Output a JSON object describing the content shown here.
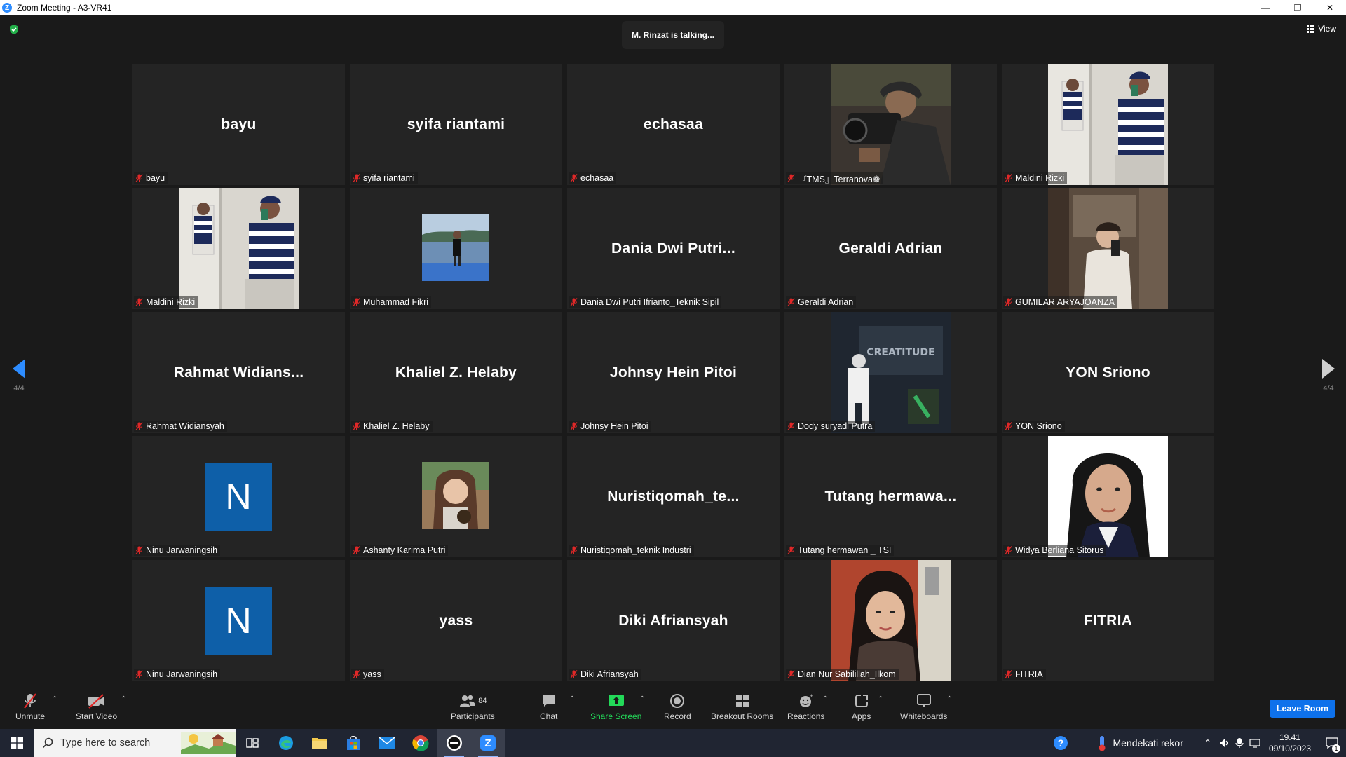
{
  "window": {
    "title": "Zoom Meeting - A3-VR41",
    "controls": [
      "minimize",
      "restore",
      "close"
    ]
  },
  "meeting": {
    "talking_indicator": "M. Rinzat is talking...",
    "view_label": "View",
    "page_left": "4/4",
    "page_right": "4/4"
  },
  "tiles": [
    {
      "display": "bayu",
      "label": "bayu",
      "kind": "name"
    },
    {
      "display": "syifa riantami",
      "label": "syifa riantami",
      "kind": "name"
    },
    {
      "display": "echasaa",
      "label": "echasaa",
      "kind": "name"
    },
    {
      "display": "",
      "label": "『TMS』Terranova❁",
      "kind": "photo",
      "photo": "camera-operator"
    },
    {
      "display": "",
      "label": "Maldini Rizki",
      "kind": "photo",
      "photo": "mirror-selfie"
    },
    {
      "display": "",
      "label": "Maldini Rizki",
      "kind": "photo",
      "photo": "mirror-selfie"
    },
    {
      "display": "",
      "label": "Muhammad Fikri",
      "kind": "photo-sm",
      "photo": "boat"
    },
    {
      "display": "Dania Dwi Putri...",
      "label": "Dania Dwi Putri Ifrianto_Teknik Sipil",
      "kind": "name"
    },
    {
      "display": "Geraldi Adrian",
      "label": "Geraldi Adrian",
      "kind": "name"
    },
    {
      "display": "",
      "label": "GUMILAR ARYAJOANZA",
      "kind": "photo",
      "photo": "selfie-room"
    },
    {
      "display": "Rahmat  Widians...",
      "label": "Rahmat Widiansyah",
      "kind": "name"
    },
    {
      "display": "Khaliel Z. Helaby",
      "label": "Khaliel Z. Helaby",
      "kind": "name"
    },
    {
      "display": "Johnsy Hein Pitoi",
      "label": "Johnsy Hein Pitoi",
      "kind": "name"
    },
    {
      "display": "",
      "label": "Dody suryadi Putra",
      "kind": "photo",
      "photo": "studio"
    },
    {
      "display": "YON Sriono",
      "label": "YON Sriono",
      "kind": "name"
    },
    {
      "display": "N",
      "label": "Ninu Jarwaningsih",
      "kind": "avatar"
    },
    {
      "display": "",
      "label": "Ashanty Karima Putri",
      "kind": "photo-sm",
      "photo": "portrait-warm"
    },
    {
      "display": "Nuristiqomah_te...",
      "label": "Nuristiqomah_teknik Industri",
      "kind": "name"
    },
    {
      "display": "Tutang  hermawa...",
      "label": "Tutang hermawan _ TSI",
      "kind": "name"
    },
    {
      "display": "",
      "label": "Widya Berliana Sitorus",
      "kind": "photo",
      "photo": "passport"
    },
    {
      "display": "N",
      "label": "Ninu Jarwaningsih",
      "kind": "avatar"
    },
    {
      "display": "yass",
      "label": "yass",
      "kind": "name"
    },
    {
      "display": "Diki Afriansyah",
      "label": "Diki Afriansyah",
      "kind": "name"
    },
    {
      "display": "",
      "label": "Dian Nur Sabilillah_Ilkom",
      "kind": "photo",
      "photo": "portrait-red"
    },
    {
      "display": "FITRIA",
      "label": "FITRIA",
      "kind": "name"
    }
  ],
  "toolbar": {
    "unmute": "Unmute",
    "start_video": "Start Video",
    "participants": "Participants",
    "participants_count": "84",
    "chat": "Chat",
    "share_screen": "Share Screen",
    "record": "Record",
    "breakout_rooms": "Breakout Rooms",
    "reactions": "Reactions",
    "apps": "Apps",
    "whiteboards": "Whiteboards",
    "leave_room": "Leave Room"
  },
  "taskbar": {
    "search_placeholder": "Type here to search",
    "weather": "Mendekati rekor",
    "time": "19.41",
    "date": "09/10/2023",
    "notifications": "1"
  },
  "colors": {
    "zoom_blue": "#2d8cff",
    "share_green": "#23d959",
    "leave_blue": "#0e71eb",
    "muted_red": "#e02828",
    "avatar_blue": "#0e5fa8"
  }
}
